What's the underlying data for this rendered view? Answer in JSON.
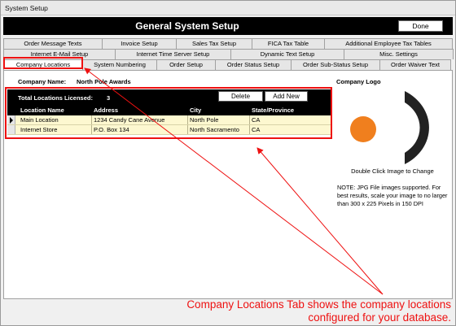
{
  "window": {
    "title": "System Setup"
  },
  "header": {
    "title": "General System Setup",
    "done_label": "Done"
  },
  "tabs": {
    "row1": [
      "Order Message Texts",
      "Invoice Setup",
      "Sales Tax Setup",
      "FICA Tax Table",
      "Additional Employee Tax Tables"
    ],
    "row2": [
      "Internet E-Mail Setup",
      "Internet Time Server Setup",
      "Dynamic Text Setup",
      "Misc. Settings"
    ],
    "row3": [
      "Company Locations",
      "System Numbering",
      "Order Setup",
      "Order Status Setup",
      "Order Sub-Status Setup",
      "Order Waiver Text"
    ],
    "active": "Company Locations"
  },
  "company": {
    "label": "Company Name:",
    "value": "North Pole Awards"
  },
  "locations": {
    "licensed_label": "Total Locations Licensed:",
    "licensed_value": "3",
    "delete_label": "Delete",
    "add_label": "Add New",
    "columns": [
      "Location Name",
      "Address",
      "City",
      "State/Province"
    ],
    "rows": [
      [
        "Main Location",
        "1234 Candy Cane Avenue",
        "North Pole",
        "CA"
      ],
      [
        "Internet Store",
        "P.O. Box 134",
        "North Sacramento",
        "CA"
      ]
    ]
  },
  "logo": {
    "label": "Company Logo",
    "hint": "Double Click Image to Change",
    "note": "NOTE: JPG File images supported. For best results, scale your image to no larger than 300 x 225 Pixels in 150 DPI",
    "colors": {
      "circle": "#f07f1e",
      "arc": "#222222"
    }
  },
  "callout": {
    "line1": "Company Locations Tab shows the company locations",
    "line2": "configured for your database.",
    "color": "#e11111"
  }
}
